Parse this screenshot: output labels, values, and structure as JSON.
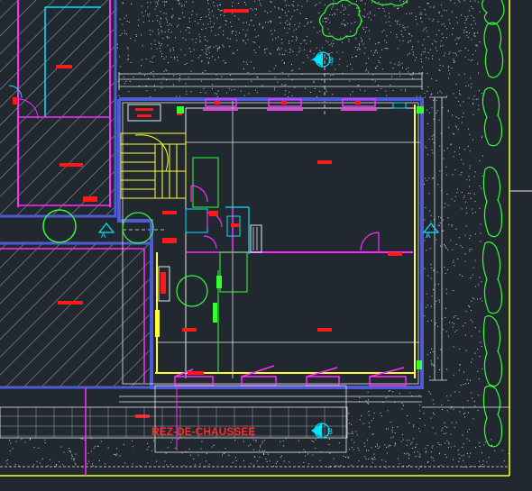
{
  "drawing": {
    "floor_title": "REZ-DE-CHAUSSÉE",
    "section_marker_label": "B",
    "side_marker_label": "A",
    "colors": {
      "background": "#212830",
      "wall_blue": "#4e5bd4",
      "magenta": "#ff2cff",
      "cyan": "#00e5ff",
      "yellow": "#ffff33",
      "green": "#33ff33",
      "red": "#ff1a1a",
      "white": "#e6e6e6"
    }
  }
}
